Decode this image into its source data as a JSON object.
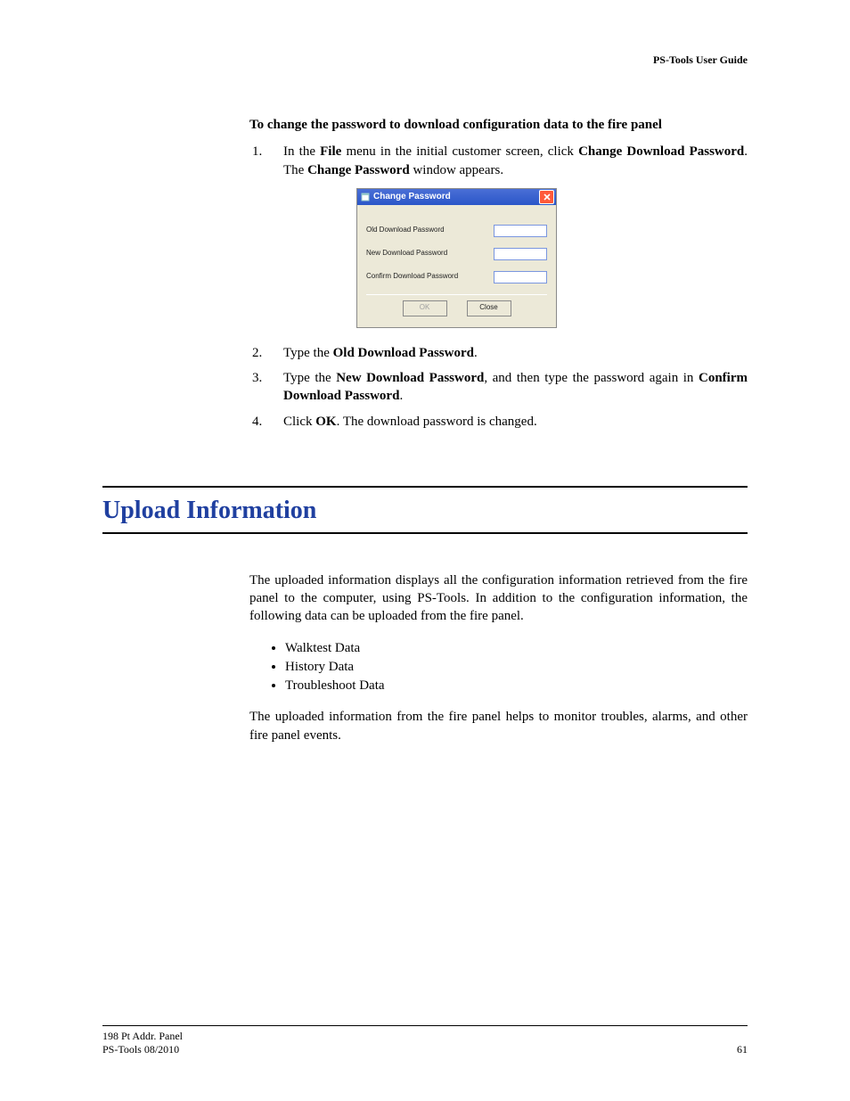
{
  "header": {
    "doc_title": "PS-Tools User Guide"
  },
  "section1": {
    "heading": "To change the password to download configuration data to the fire panel",
    "step1_pre": "In the ",
    "step1_bold1": "File",
    "step1_mid": " menu in the initial customer screen, click ",
    "step1_bold2": "Change Download Password",
    "step1_post": ". The ",
    "step1_bold3": "Change Password",
    "step1_tail": " window appears.",
    "step2_pre": "Type the ",
    "step2_bold": "Old Download Password",
    "step2_post": ".",
    "step3_pre": "Type the ",
    "step3_bold1": "New Download Password",
    "step3_mid": ", and then type the password again in ",
    "step3_bold2": "Confirm Download Password",
    "step3_post": ".",
    "step4_pre": "Click ",
    "step4_bold": "OK",
    "step4_post": ". The download password is changed."
  },
  "dialog": {
    "title": "Change Password",
    "label_old": "Old Download Password",
    "label_new": "New Download Password",
    "label_confirm": "Confirm Download Password",
    "btn_ok": "OK",
    "btn_close": "Close"
  },
  "section2": {
    "title": "Upload Information",
    "para1": "The uploaded information displays all the configuration information retrieved from the fire panel to the computer, using PS-Tools. In addition to the configuration information, the following data can be uploaded from the fire panel.",
    "bullets": [
      "Walktest Data",
      "History Data",
      "Troubleshoot Data"
    ],
    "para2": "The uploaded information from the fire panel helps to monitor troubles, alarms, and other fire panel events."
  },
  "footer": {
    "line1": "198 Pt Addr. Panel",
    "line2": "PS-Tools  08/2010",
    "page": "61"
  }
}
